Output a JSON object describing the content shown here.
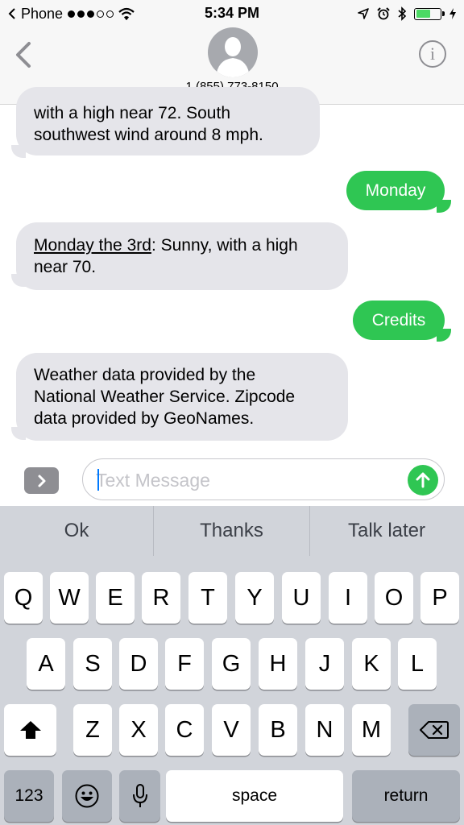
{
  "status_bar": {
    "carrier": "Phone",
    "time": "5:34 PM",
    "battery_level": 0.62
  },
  "header": {
    "contact": "1 (855) 773-8150",
    "info_glyph": "i"
  },
  "messages": [
    {
      "direction": "incoming",
      "lines": [
        "with a high near 72. South",
        "southwest wind around 8 mph."
      ]
    },
    {
      "direction": "outgoing",
      "text": "Monday"
    },
    {
      "direction": "incoming",
      "link": "Monday the 3rd",
      "rest": ": Sunny, with a high",
      "line2": "near 70."
    },
    {
      "direction": "outgoing",
      "text": "Credits"
    },
    {
      "direction": "incoming",
      "lines": [
        "Weather data provided by the",
        "National Weather Service. Zipcode",
        "data provided by GeoNames."
      ]
    }
  ],
  "input": {
    "placeholder": "Text Message",
    "value": ""
  },
  "suggestions": [
    "Ok",
    "Thanks",
    "Talk later"
  ],
  "keyboard": {
    "row1": [
      "Q",
      "W",
      "E",
      "R",
      "T",
      "Y",
      "U",
      "I",
      "O",
      "P"
    ],
    "row2": [
      "A",
      "S",
      "D",
      "F",
      "G",
      "H",
      "J",
      "K",
      "L"
    ],
    "row3": [
      "Z",
      "X",
      "C",
      "V",
      "B",
      "N",
      "M"
    ],
    "numbers_label": "123",
    "space_label": "space",
    "return_label": "return"
  },
  "colors": {
    "outgoing_bubble": "#2fc653",
    "incoming_bubble": "#e5e5ea",
    "keyboard_bg": "#d1d4da",
    "send_button": "#2fc653",
    "battery_fill": "#4cd964"
  },
  "icons": {
    "back": "chevron-left-icon",
    "avatar": "person-silhouette-icon",
    "info": "info-icon",
    "expand": "chevron-right-icon",
    "send": "arrow-up-icon",
    "shift": "shift-arrow-icon",
    "delete": "backspace-icon",
    "emoji": "smiley-icon",
    "dictation": "microphone-icon"
  }
}
